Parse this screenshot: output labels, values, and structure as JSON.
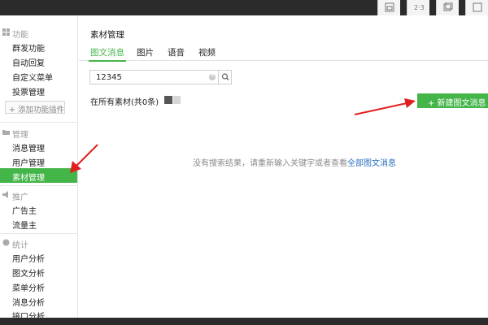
{
  "sidebar": {
    "sections": [
      {
        "title": "功能",
        "icon": "grid-icon",
        "items": [
          "群发功能",
          "自动回复",
          "自定义菜单",
          "投票管理"
        ]
      },
      {
        "title": "管理",
        "icon": "folder-icon",
        "items": [
          "消息管理",
          "用户管理",
          "素材管理"
        ]
      },
      {
        "title": "推广",
        "icon": "megaphone-icon",
        "items": [
          "广告主",
          "流量主"
        ]
      },
      {
        "title": "统计",
        "icon": "chart-icon",
        "items": [
          "用户分析",
          "图文分析",
          "菜单分析",
          "消息分析",
          "接口分析"
        ]
      }
    ],
    "add_plugin_label": "+ 添加功能插件",
    "active_item": "素材管理"
  },
  "main": {
    "page_title": "素材管理",
    "tabs": [
      {
        "label": "图文消息",
        "active": true
      },
      {
        "label": "图片",
        "active": false
      },
      {
        "label": "语音",
        "active": false
      },
      {
        "label": "视频",
        "active": false
      }
    ],
    "search": {
      "value": "12345"
    },
    "count_text": "在所有素材(共0条)",
    "new_button_label": "+ 新建图文消息",
    "empty_message": "没有搜索结果，请重新输入关键字或者查看",
    "empty_link": "全部图文消息"
  },
  "colors": {
    "accent": "#44b549",
    "link": "#2a6fbf",
    "annotation_arrow": "#e02020"
  }
}
